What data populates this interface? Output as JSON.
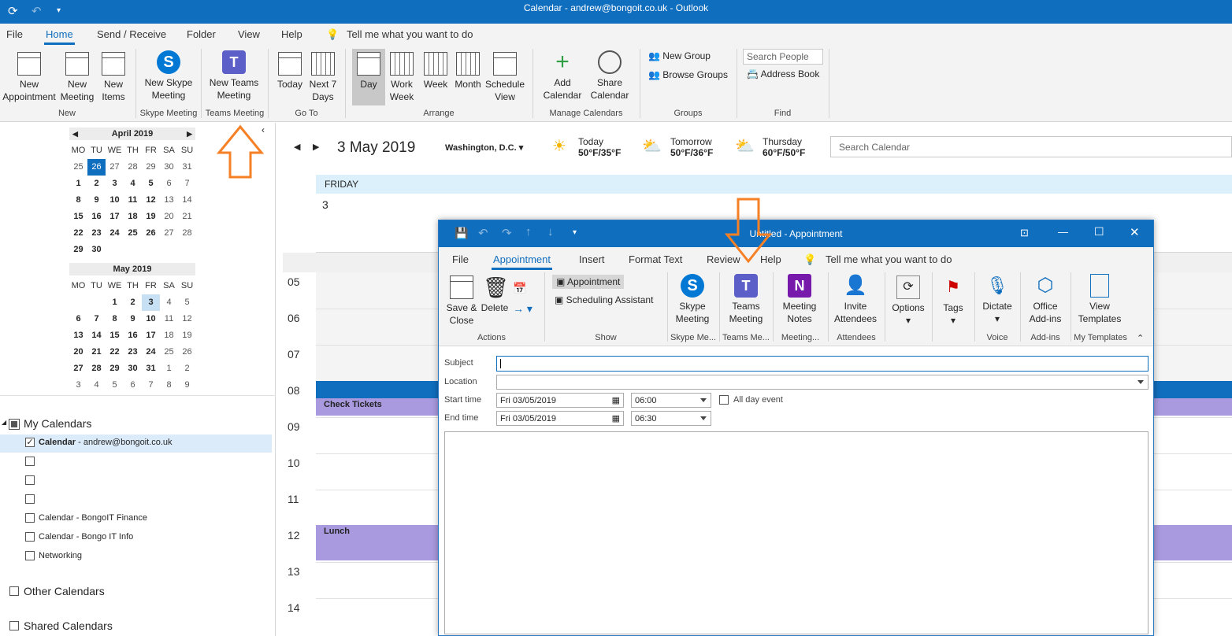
{
  "titlebar": {
    "title": "Calendar - andrew@bongoit.co.uk  -  Outlook"
  },
  "tabs": [
    {
      "label": "File"
    },
    {
      "label": "Home"
    },
    {
      "label": "Send / Receive"
    },
    {
      "label": "Folder"
    },
    {
      "label": "View"
    },
    {
      "label": "Help"
    }
  ],
  "tellme": "Tell me what you want to do",
  "ribbon": {
    "new_appointment": "New\nAppointment",
    "new_meeting": "New\nMeeting",
    "new_items": "New\nItems",
    "new_skype": "New Skype\nMeeting",
    "new_teams": "New Teams\nMeeting",
    "today": "Today",
    "next7": "Next 7\nDays",
    "day": "Day",
    "work_week": "Work\nWeek",
    "week": "Week",
    "month": "Month",
    "schedule_view": "Schedule\nView",
    "add_calendar": "Add\nCalendar",
    "share_calendar": "Share\nCalendar",
    "new_group": "New Group",
    "browse_groups": "Browse Groups",
    "search_people": "Search People",
    "address_book": "Address Book",
    "groups": {
      "new": "New",
      "skype": "Skype Meeting",
      "teams": "Teams Meeting",
      "goto": "Go To",
      "arrange": "Arrange",
      "manage": "Manage Calendars",
      "groups": "Groups",
      "find": "Find"
    }
  },
  "minical": {
    "april_title": "April 2019",
    "may_title": "May 2019",
    "dow": [
      "MO",
      "TU",
      "WE",
      "TH",
      "FR",
      "SA",
      "SU"
    ],
    "april": [
      [
        "25",
        "26",
        "27",
        "28",
        "29",
        "30",
        "31"
      ],
      [
        "1",
        "2",
        "3",
        "4",
        "5",
        "6",
        "7"
      ],
      [
        "8",
        "9",
        "10",
        "11",
        "12",
        "13",
        "14"
      ],
      [
        "15",
        "16",
        "17",
        "18",
        "19",
        "20",
        "21"
      ],
      [
        "22",
        "23",
        "24",
        "25",
        "26",
        "27",
        "28"
      ],
      [
        "29",
        "30",
        "",
        "",
        "",
        "",
        ""
      ]
    ],
    "may": [
      [
        "",
        "",
        "1",
        "2",
        "3",
        "4",
        "5"
      ],
      [
        "6",
        "7",
        "8",
        "9",
        "10",
        "11",
        "12"
      ],
      [
        "13",
        "14",
        "15",
        "16",
        "17",
        "18",
        "19"
      ],
      [
        "20",
        "21",
        "22",
        "23",
        "24",
        "25",
        "26"
      ],
      [
        "27",
        "28",
        "29",
        "30",
        "31",
        "1",
        "2"
      ],
      [
        "3",
        "4",
        "5",
        "6",
        "7",
        "8",
        "9"
      ]
    ]
  },
  "folders": {
    "my_calendars": "My Calendars",
    "calendar_bold": "Calendar",
    "calendar_rest": " - andrew@bongoit.co.uk",
    "finance": "Calendar - BongoIT Finance",
    "info": "Calendar - Bongo IT Info",
    "networking": "Networking",
    "other": "Other Calendars",
    "shared": "Shared Calendars"
  },
  "main": {
    "date": "3 May 2019",
    "location": "Washington, D.C.",
    "weather": [
      {
        "day": "Today",
        "temp": "50°F/35°F"
      },
      {
        "day": "Tomorrow",
        "temp": "50°F/36°F"
      },
      {
        "day": "Thursday",
        "temp": "60°F/50°F"
      }
    ],
    "search_placeholder": "Search Calendar",
    "dayname": "FRIDAY",
    "daynum": "3",
    "hours": [
      "05",
      "06",
      "07",
      "08",
      "09",
      "10",
      "11",
      "12",
      "13",
      "14"
    ],
    "events": [
      {
        "title": "Check Tickets"
      },
      {
        "title": "Lunch"
      }
    ]
  },
  "dialog": {
    "title": "Untitled  -  Appointment",
    "tabs": [
      {
        "label": "File"
      },
      {
        "label": "Appointment"
      },
      {
        "label": "Insert"
      },
      {
        "label": "Format Text"
      },
      {
        "label": "Review"
      },
      {
        "label": "Help"
      }
    ],
    "tellme": "Tell me what you want to do",
    "save_close": "Save &\nClose",
    "delete": "Delete",
    "appointment": "Appointment",
    "scheduling": "Scheduling Assistant",
    "skype": "Skype\nMeeting",
    "teams": "Teams\nMeeting",
    "notes": "Meeting\nNotes",
    "invite": "Invite\nAttendees",
    "options": "Options",
    "tags": "Tags",
    "dictate": "Dictate",
    "addins": "Office\nAdd-ins",
    "templates": "View\nTemplates",
    "groups": {
      "actions": "Actions",
      "show": "Show",
      "skype": "Skype Me...",
      "teams": "Teams Me...",
      "meeting": "Meeting...",
      "attendees": "Attendees",
      "voice": "Voice",
      "addins": "Add-ins",
      "templates": "My Templates"
    },
    "subject_label": "Subject",
    "location_label": "Location",
    "start_label": "Start time",
    "end_label": "End time",
    "start_date": "Fri 03/05/2019",
    "start_time": "06:00",
    "end_date": "Fri 03/05/2019",
    "end_time": "06:30",
    "allday": "All day event"
  },
  "colors": {
    "accent": "#106ebe",
    "event": "#a99ae0",
    "arrow": "#f58025"
  }
}
